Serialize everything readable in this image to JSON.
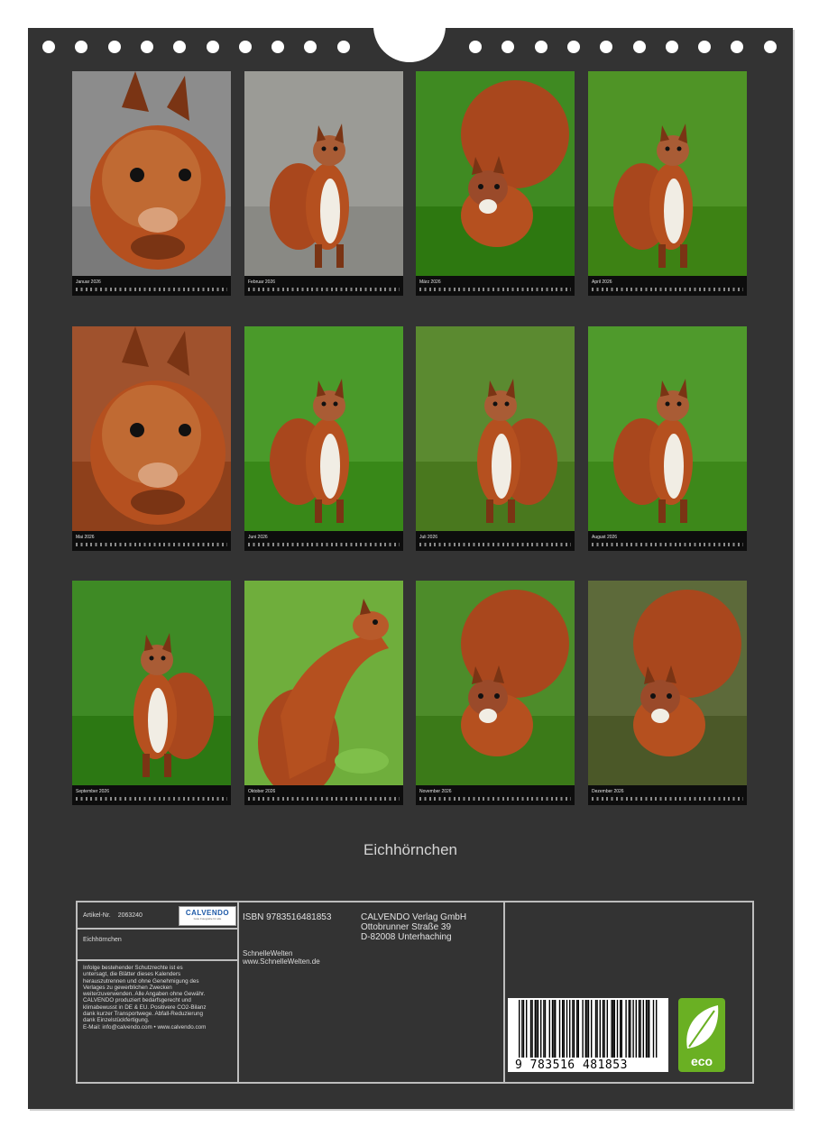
{
  "calendar": {
    "title": "Eichhörnchen",
    "months": [
      {
        "label": "Januar 2026",
        "scene": "portrait",
        "bg": "#8c8c8c"
      },
      {
        "label": "Februar 2026",
        "scene": "standing",
        "bg": "#9b9b96"
      },
      {
        "label": "März 2026",
        "scene": "tail-up",
        "bg": "#3f8a22"
      },
      {
        "label": "April 2026",
        "scene": "reaching",
        "bg": "#4f9426"
      },
      {
        "label": "Mai 2026",
        "scene": "closeup",
        "bg": "#a0522d"
      },
      {
        "label": "Juni 2026",
        "scene": "stretching",
        "bg": "#4a9a2a"
      },
      {
        "label": "Juli 2026",
        "scene": "upright",
        "bg": "#5b8a30"
      },
      {
        "label": "August 2026",
        "scene": "running",
        "bg": "#4f9a2c"
      },
      {
        "label": "September 2026",
        "scene": "upright-tail",
        "bg": "#3e8a25"
      },
      {
        "label": "Oktober 2026",
        "scene": "branch",
        "bg": "#6fae3c"
      },
      {
        "label": "November 2026",
        "scene": "grass",
        "bg": "#4d8c2a"
      },
      {
        "label": "Dezember 2026",
        "scene": "stump",
        "bg": "#5d6a3a"
      }
    ]
  },
  "info": {
    "article_label": "Artikel-Nr.",
    "article_number": "2063240",
    "logo_text": "CALVENDO",
    "logo_sub": "Gute Fotografie für alle",
    "product_name": "Eichhörnchen",
    "legal_lines": [
      "Infolge bestehender Schutzrechte ist es",
      "untersagt, die Blätter dieses Kalenders",
      "herauszutrennen und ohne Genehmigung des",
      "Verlages zu gewerblichen Zwecken",
      "weiterzuverwenden. Alle Angaben ohne Gewähr.",
      "CALVENDO produziert bedarfsgerecht und",
      "klimabewusst in DE & EU. Positivere CO2-Bilanz",
      "dank kurzer Transportwege. Abfall-Reduzierung",
      "dank Einzelstückfertigung.",
      "E-Mail: info@calvendo.com • www.calvendo.com"
    ],
    "isbn": "ISBN 9783516481853",
    "author": "SchnelleWelten",
    "author_url": "www.SchnelleWelten.de",
    "publisher_lines": [
      "CALVENDO Verlag GmbH",
      "Ottobrunner Straße 39",
      "D-82008 Unterhaching"
    ],
    "barcode_digits": "9 783516 481853",
    "eco_label": "eco",
    "colors": {
      "page": "#333333",
      "frame": "#bdbdbd",
      "fur": "#b5501f",
      "eco": "#6ab023"
    }
  }
}
